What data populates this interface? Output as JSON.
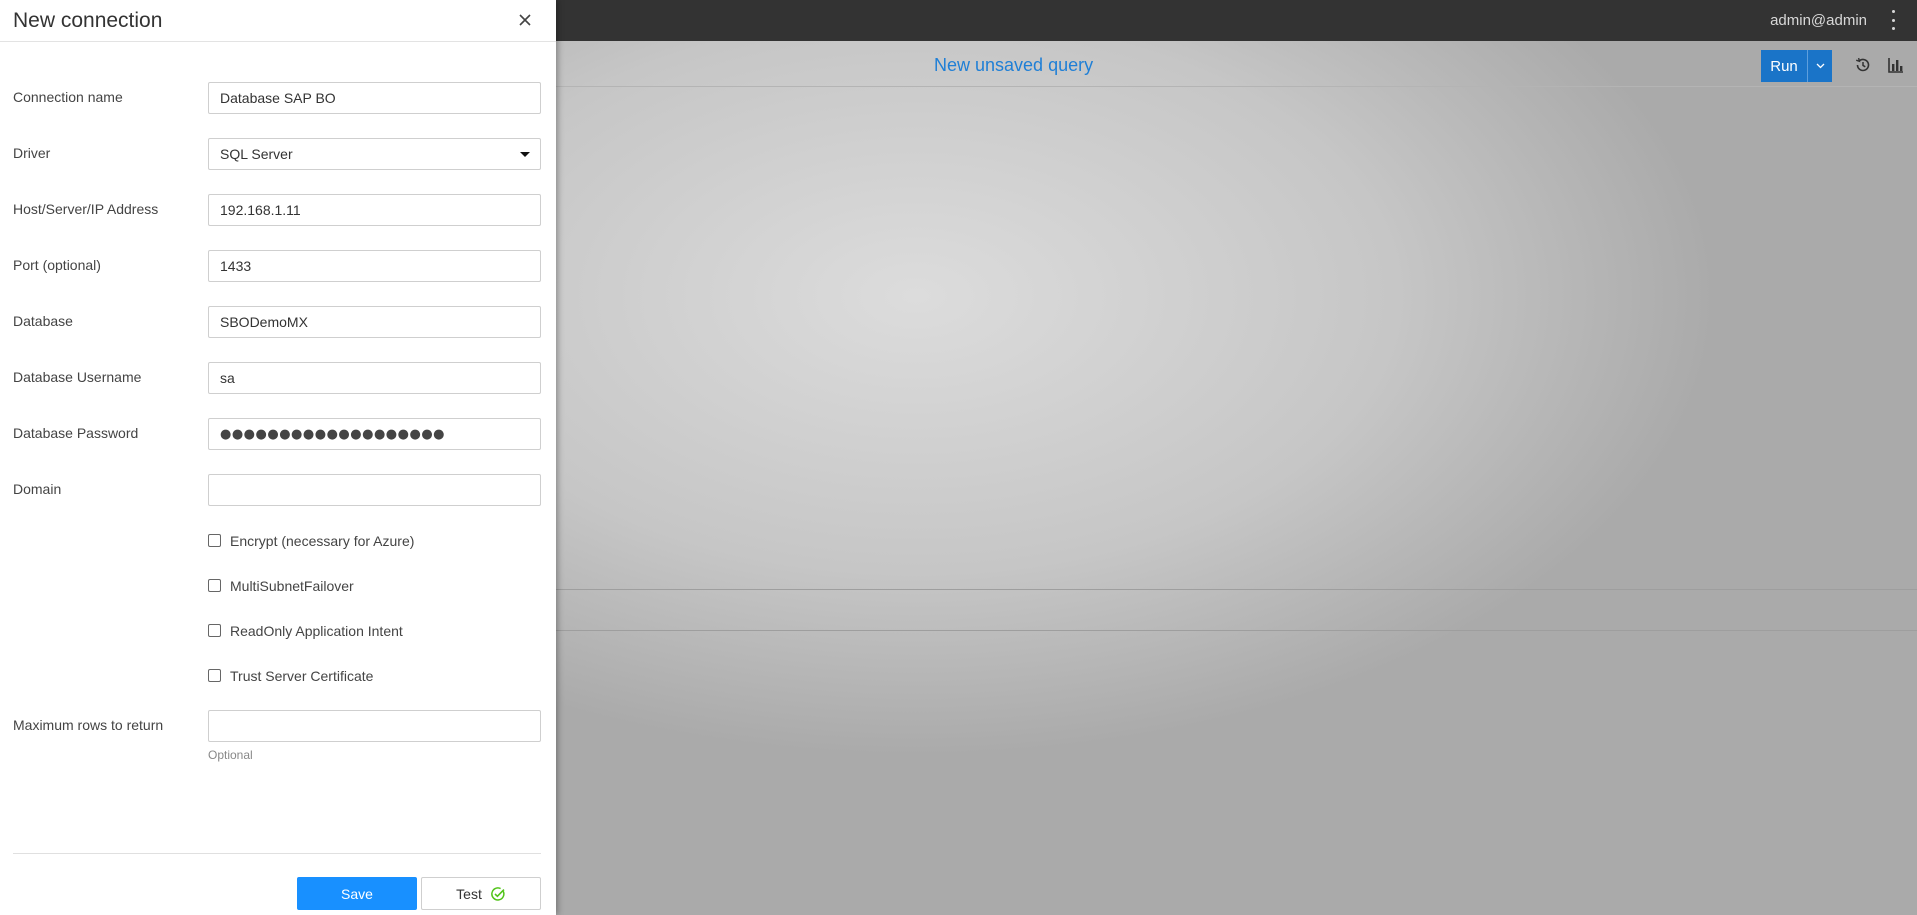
{
  "topbar": {
    "user": "admin@admin",
    "menu_icon": "kebab-menu-icon"
  },
  "query": {
    "title": "New unsaved query",
    "run_label": "Run",
    "icons": [
      "history-icon",
      "chart-icon"
    ],
    "accent_color": "#1a74c8"
  },
  "drawer": {
    "title": "New connection",
    "fields": {
      "connection_name": {
        "label": "Connection name",
        "value": "Database SAP BO"
      },
      "driver": {
        "label": "Driver",
        "value": "SQL Server"
      },
      "host": {
        "label": "Host/Server/IP Address",
        "value": "192.168.1.11"
      },
      "port": {
        "label": "Port (optional)",
        "value": "1433"
      },
      "database": {
        "label": "Database",
        "value": "SBODemoMX"
      },
      "username": {
        "label": "Database Username",
        "value": "sa"
      },
      "password": {
        "label": "Database Password",
        "value": "●●●●●●●●●●●●●●●●●●●"
      },
      "domain": {
        "label": "Domain",
        "value": ""
      },
      "max_rows": {
        "label": "Maximum rows to return",
        "value": "",
        "hint": "Optional"
      }
    },
    "checkboxes": {
      "encrypt": {
        "label": "Encrypt (necessary for Azure)",
        "checked": false
      },
      "multisubnet": {
        "label": "MultiSubnetFailover",
        "checked": false
      },
      "readonly": {
        "label": "ReadOnly Application Intent",
        "checked": false
      },
      "trust_cert": {
        "label": "Trust Server Certificate",
        "checked": false
      }
    },
    "buttons": {
      "save": "Save",
      "test": "Test"
    },
    "colors": {
      "primary": "#1890ff",
      "success": "#52c41a"
    }
  }
}
